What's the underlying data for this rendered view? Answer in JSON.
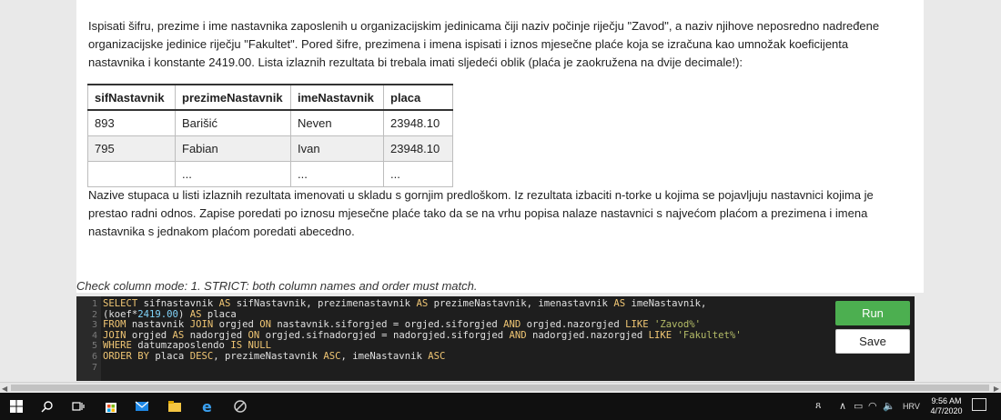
{
  "task": {
    "paragraph1": "Ispisati šifru, prezime i ime nastavnika zaposlenih u organizacijskim jedinicama čiji naziv počinje riječju \"Zavod\", a naziv njihove neposredno nadređene organizacijske jedinice riječju \"Fakultet\". Pored šifre, prezimena i imena ispisati i iznos mjesečne plaće koja se izračuna kao umnožak koeficijenta nastavnika i konstante 2419.00. Lista izlaznih rezultata bi trebala imati sljedeći oblik (plaća je zaokružena na dvije decimale!):",
    "paragraph2": "Nazive stupaca u listi izlaznih rezultata imenovati u skladu s gornjim predloškom. Iz rezultata izbaciti n-torke u kojima se pojavljuju nastavnici kojima je prestao radni odnos. Zapise poredati po iznosu mjesečne plaće tako da se na vrhu popisa nalaze nastavnici s najvećom plaćom a prezimena i imena nastavnika s jednakom plaćom poredati abecedno."
  },
  "result_table": {
    "headers": [
      "sifNastavnik",
      "prezimeNastavnik",
      "imeNastavnik",
      "placa"
    ],
    "rows": [
      [
        "893",
        "Barišić",
        "Neven",
        "23948.10"
      ],
      [
        "795",
        "Fabian",
        "Ivan",
        "23948.10"
      ],
      [
        "",
        "...",
        "...",
        "..."
      ]
    ]
  },
  "check_mode": "Check column mode: 1. STRICT: both column names and order must match.",
  "editor": {
    "line_numbers": [
      "1",
      "2",
      "3",
      "4",
      "5",
      "6",
      "7"
    ],
    "lines": [
      [
        [
          "kw",
          "SELECT"
        ],
        [
          "op",
          " sifnastavnik "
        ],
        [
          "kw",
          "AS"
        ],
        [
          "op",
          " sifNastavnik, prezimenastavnik "
        ],
        [
          "kw",
          "AS"
        ],
        [
          "op",
          " prezimeNastavnik, imenastavnik "
        ],
        [
          "kw",
          "AS"
        ],
        [
          "op",
          " imeNastavnik,"
        ]
      ],
      [
        [
          "op",
          "(koef*"
        ],
        [
          "num",
          "2419.00"
        ],
        [
          "op",
          ") "
        ],
        [
          "kw",
          "AS"
        ],
        [
          "op",
          " placa"
        ]
      ],
      [
        [
          "kw",
          "FROM"
        ],
        [
          "op",
          " nastavnik "
        ],
        [
          "kw",
          "JOIN"
        ],
        [
          "op",
          " orgjed "
        ],
        [
          "kw",
          "ON"
        ],
        [
          "op",
          " nastavnik.siforgjed = orgjed.siforgjed "
        ],
        [
          "kw",
          "AND"
        ],
        [
          "op",
          " orgjed.nazorgjed "
        ],
        [
          "kw",
          "LIKE"
        ],
        [
          "op",
          " "
        ],
        [
          "str",
          "'Zavod%'"
        ]
      ],
      [
        [
          "kw",
          "JOIN"
        ],
        [
          "op",
          " orgjed "
        ],
        [
          "kw",
          "AS"
        ],
        [
          "op",
          " nadorgjed "
        ],
        [
          "kw",
          "ON"
        ],
        [
          "op",
          " orgjed.sifnadorgjed = nadorgjed.siforgjed "
        ],
        [
          "kw",
          "AND"
        ],
        [
          "op",
          " nadorgjed.nazorgjed "
        ],
        [
          "kw",
          "LIKE"
        ],
        [
          "op",
          " "
        ],
        [
          "str",
          "'Fakultet%'"
        ]
      ],
      [
        [
          "kw",
          "WHERE"
        ],
        [
          "op",
          " datumzaposlendo "
        ],
        [
          "kw",
          "IS NULL"
        ]
      ],
      [
        [
          "kw",
          "ORDER BY"
        ],
        [
          "op",
          " placa "
        ],
        [
          "kw",
          "DESC"
        ],
        [
          "op",
          ", prezimeNastavnik "
        ],
        [
          "kw",
          "ASC"
        ],
        [
          "op",
          ", imeNastavnik "
        ],
        [
          "kw",
          "ASC"
        ]
      ],
      []
    ]
  },
  "buttons": {
    "run": "Run",
    "save": "Save"
  },
  "taskbar": {
    "language": "HRV",
    "time": "9:56 AM",
    "date": "4/7/2020"
  }
}
